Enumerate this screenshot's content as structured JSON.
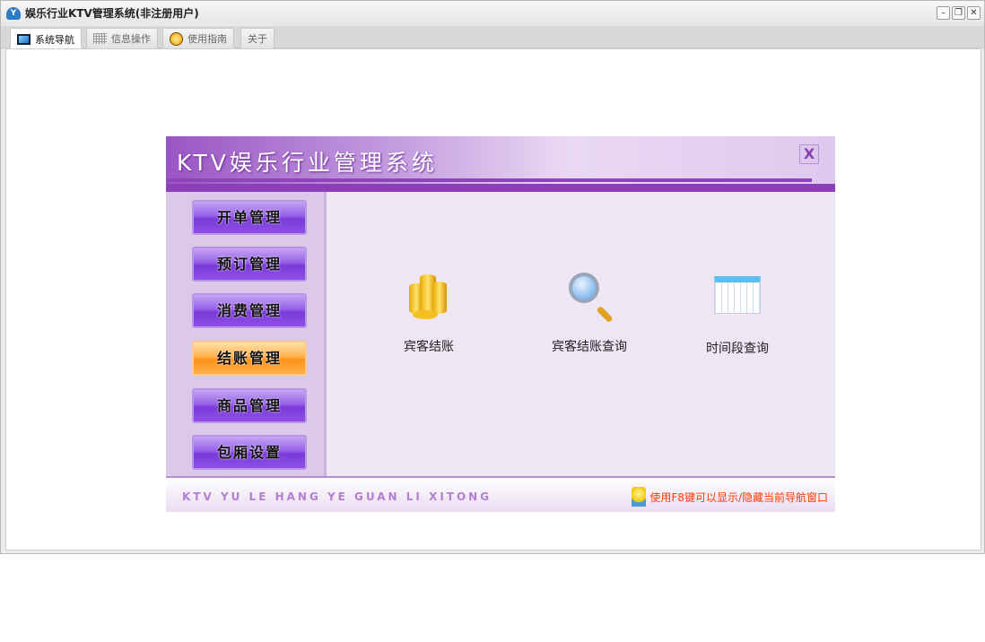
{
  "window": {
    "title": "娱乐行业KTV管理系统(非注册用户)",
    "app_icon": "Y"
  },
  "tabs": [
    {
      "label": "系统导航",
      "icon": "monitor-icon"
    },
    {
      "label": "信息操作",
      "icon": "grid-icon"
    },
    {
      "label": "使用指南",
      "icon": "help-icon"
    },
    {
      "label": "关于"
    }
  ],
  "panel": {
    "title": "KTV娱乐行业管理系统",
    "close": "X",
    "nav": [
      {
        "label": "开单管理"
      },
      {
        "label": "预订管理"
      },
      {
        "label": "消费管理"
      },
      {
        "label": "结账管理",
        "active": true
      },
      {
        "label": "商品管理"
      },
      {
        "label": "包厢设置"
      }
    ],
    "actions": [
      {
        "label": "宾客结账",
        "icon": "coins-icon"
      },
      {
        "label": "宾客结账查询",
        "icon": "magnifier-icon"
      },
      {
        "label": "时间段查询",
        "icon": "calendar-icon"
      }
    ],
    "footer_left": "KTV YU LE HANG YE GUAN LI XITONG",
    "footer_hint": "使用F8键可以显示/隐藏当前导航窗口"
  },
  "colors": {
    "accent": "#8d3fba",
    "hint": "#ff3a00",
    "active": "#ff9218"
  }
}
